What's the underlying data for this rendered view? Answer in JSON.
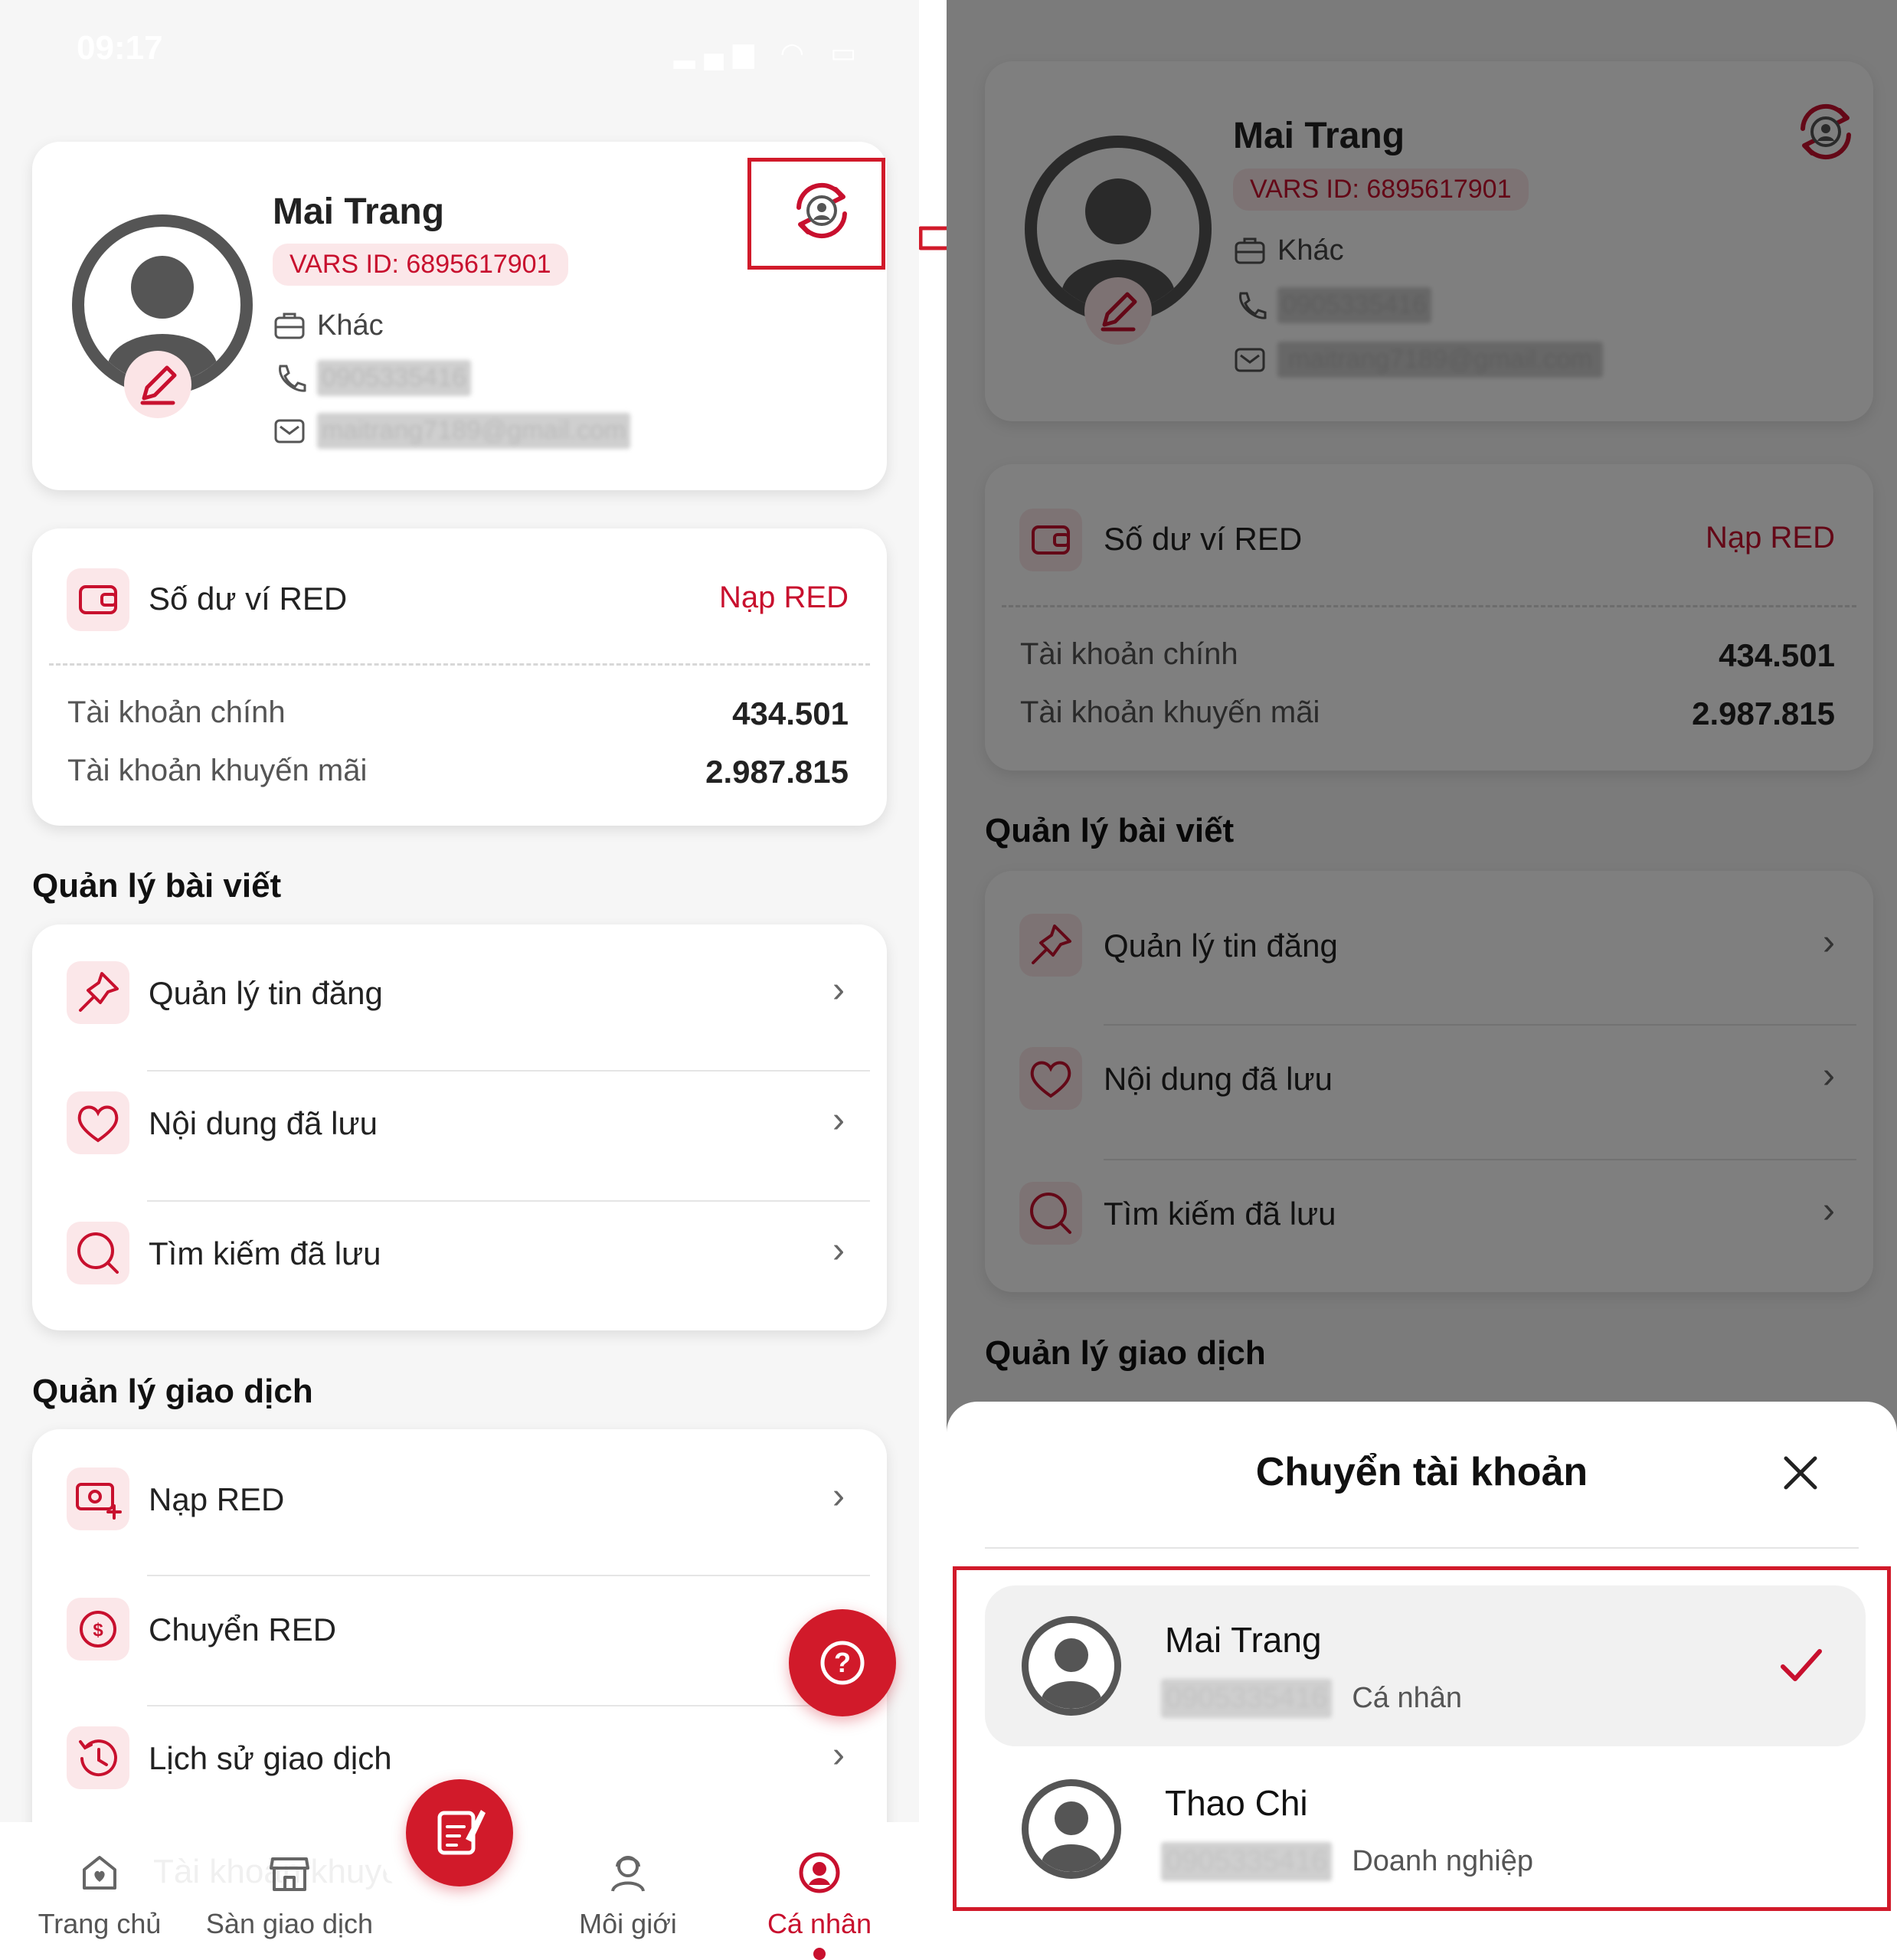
{
  "status_bar": {
    "time": "09:17"
  },
  "profile": {
    "name": "Mai Trang",
    "vars_id": "VARS ID: 6895617901",
    "type": "Khác",
    "phone": "0905335416",
    "email": "maitrang7189@gmail.com"
  },
  "wallet": {
    "title": "Số dư ví RED",
    "top_up": "Nạp RED",
    "main_label": "Tài khoản chính",
    "main_value": "434.501",
    "promo_label": "Tài khoản khuyến mãi",
    "promo_value": "2.987.815"
  },
  "posts_section": {
    "title": "Quản lý bài viết",
    "items": [
      {
        "label": "Quản lý tin đăng",
        "icon": "pin-icon"
      },
      {
        "label": "Nội dung đã lưu",
        "icon": "heart-icon"
      },
      {
        "label": "Tìm kiếm đã lưu",
        "icon": "search-icon"
      }
    ]
  },
  "transactions_section": {
    "title": "Quản lý giao dịch",
    "items": [
      {
        "label": "Nạp RED",
        "icon": "money-plus-icon"
      },
      {
        "label": "Chuyển RED",
        "icon": "coin-transfer-icon"
      },
      {
        "label": "Lịch sử giao dịch",
        "icon": "history-icon"
      }
    ]
  },
  "ghost_text": "Tài khoản khuyến mãi",
  "nav": {
    "items": [
      {
        "label": "Trang chủ",
        "icon": "home-icon"
      },
      {
        "label": "Sàn giao dịch",
        "icon": "store-icon"
      },
      {
        "label": "",
        "icon": "compose-icon"
      },
      {
        "label": "Môi giới",
        "icon": "broker-icon"
      },
      {
        "label": "Cá nhân",
        "icon": "profile-icon"
      }
    ],
    "active_index": 4
  },
  "switch_sheet": {
    "title": "Chuyển tài khoản",
    "accounts": [
      {
        "name": "Mai Trang",
        "phone": "0905335416",
        "type": "Cá nhân",
        "selected": true
      },
      {
        "name": "Thao Chi",
        "phone": "0905335416",
        "type": "Doanh nghiệp",
        "selected": false
      }
    ]
  },
  "colors": {
    "brand_red": "#d11a2a",
    "badge_bg": "#fbe7e9",
    "text_dark": "#222222"
  }
}
